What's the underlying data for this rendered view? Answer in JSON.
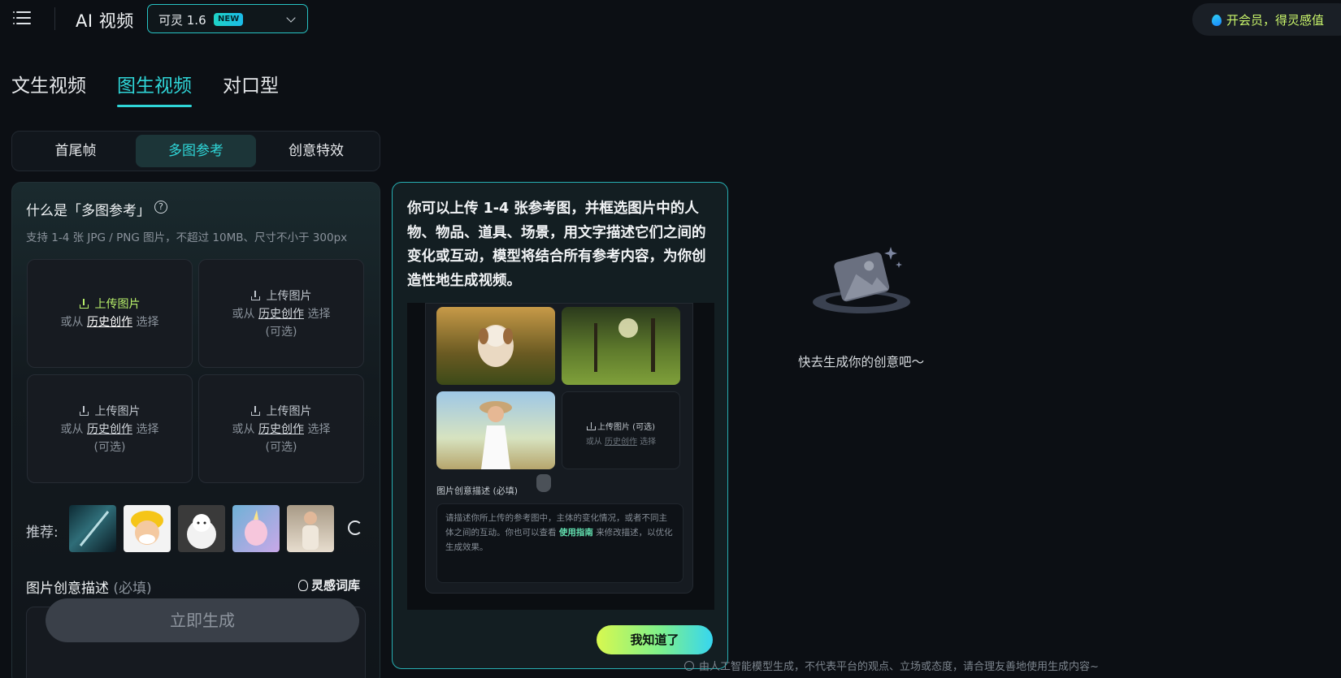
{
  "header": {
    "app_title": "AI 视频",
    "model": {
      "name": "可灵 1.6",
      "badge": "NEW"
    },
    "vip_text": "开会员，得灵感值"
  },
  "mode_tabs": [
    {
      "label": "文生视频",
      "active": false
    },
    {
      "label": "图生视频",
      "active": true
    },
    {
      "label": "对口型",
      "active": false
    }
  ],
  "sub_tabs": [
    {
      "label": "首尾帧",
      "active": false
    },
    {
      "label": "多图参考",
      "active": true
    },
    {
      "label": "创意特效",
      "active": false
    }
  ],
  "panel": {
    "title": "什么是「多图参考」",
    "hint": "支持 1-4 张 JPG / PNG 图片，不超过 10MB、尺寸不小于 300px",
    "uploads": [
      {
        "label": "上传图片",
        "prefix": "或从",
        "link": "历史创作",
        "suffix": "选择",
        "optional": ""
      },
      {
        "label": "上传图片",
        "prefix": "或从",
        "link": "历史创作",
        "suffix": "选择",
        "optional": "(可选)"
      },
      {
        "label": "上传图片",
        "prefix": "或从",
        "link": "历史创作",
        "suffix": "选择",
        "optional": "(可选)"
      },
      {
        "label": "上传图片",
        "prefix": "或从",
        "link": "历史创作",
        "suffix": "选择",
        "optional": "(可选)"
      }
    ],
    "recommend_label": "推荐:",
    "recommend_thumbs": [
      "sword-image",
      "cartoon-worker-image",
      "white-puppy-image",
      "pink-unicorn-image",
      "woman-portrait-image"
    ],
    "desc_label": "图片创意描述",
    "desc_required": "(必填)",
    "inspiration_label": "灵感词库",
    "generate_label": "立即生成"
  },
  "guide": {
    "text": "你可以上传 1-4 张参考图，并框选图片中的人物、物品、道具、场景，用文字描述它们之间的变化或互动，模型将结合所有参考内容，为你创造性地生成视频。",
    "demo": {
      "upload_label": "上传图片 (可选)",
      "upload_prefix": "或从",
      "upload_link": "历史创作",
      "upload_suffix": "选择",
      "desc_label": "图片创意描述 (必填)",
      "desc_text_1": "请描述你所上传的参考图中，主体的变化情况，或者不同主体之间的互动。你也可以查看",
      "desc_link": "使用指南",
      "desc_text_2": "来修改描述，以优化生成效果。"
    },
    "ok_label": "我知道了"
  },
  "empty_state": {
    "text": "快去生成你的创意吧～"
  },
  "footer": {
    "note": "由人工智能模型生成，不代表平台的观点、立场或态度，请合理友善地使用生成内容~"
  }
}
